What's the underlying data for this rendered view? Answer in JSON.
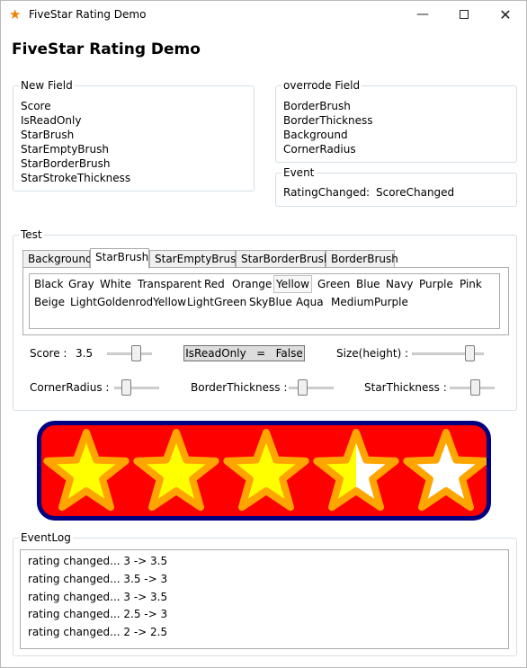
{
  "window": {
    "title": "FiveStar Rating Demo",
    "minimize_glyph": "—",
    "close_glyph": "✕"
  },
  "heading": "FiveStar Rating Demo",
  "new_field": {
    "legend": "New Field",
    "items": [
      "Score",
      "IsReadOnly",
      "StarBrush",
      "StarEmptyBrush",
      "StarBorderBrush",
      "StarStrokeThickness"
    ]
  },
  "overrode_field": {
    "legend": "overrode Field",
    "items": [
      "BorderBrush",
      "BorderThickness",
      "Background",
      "CornerRadius"
    ]
  },
  "event": {
    "legend": "Event",
    "name": "RatingChanged",
    "sep": ":",
    "value": "ScoreChanged"
  },
  "test": {
    "legend": "Test",
    "tabs": [
      "Background",
      "StarBrush",
      "StarEmptyBrush",
      "StarBorderBrush",
      "BorderBrush"
    ],
    "active_tab": "StarBrush",
    "colors_row1": [
      "Black",
      "Gray",
      "White",
      "Transparent",
      "Red",
      "Orange",
      "Yellow",
      "Green",
      "Blue",
      "Navy",
      "Purple",
      "Pink"
    ],
    "colors_row2": [
      "Beige",
      "LightGoldenrodYellow",
      "LightGreen",
      "SkyBlue",
      "Aqua",
      "MediumPurple"
    ],
    "selected_color": "Yellow",
    "score_label": "Score :",
    "score_value": "3.5",
    "score_slider_fraction": 0.7,
    "readonly_button": "IsReadOnly   =   False",
    "size_label": "Size(height) :",
    "size_slider_fraction": 0.85,
    "corner_radius_label": "CornerRadius :",
    "corner_radius_slider_fraction": 0.2,
    "border_thickness_label": "BorderThickness :",
    "border_thickness_slider_fraction": 0.25,
    "star_thickness_label": "StarThickness :",
    "star_thickness_slider_fraction": 0.6
  },
  "rating": {
    "score": 3.5,
    "max": 5,
    "colors": {
      "background": "#ff0000",
      "border": "#000080",
      "star_fill": "#ffff00",
      "star_empty": "#ffffff",
      "star_border": "#ffa500"
    }
  },
  "event_log": {
    "legend": "EventLog",
    "lines": [
      "rating changed... 3 -> 3.5",
      "rating changed... 3.5 -> 3",
      "rating changed... 3 -> 3.5",
      "rating changed... 2.5 -> 3",
      "rating changed... 2 -> 2.5"
    ]
  }
}
